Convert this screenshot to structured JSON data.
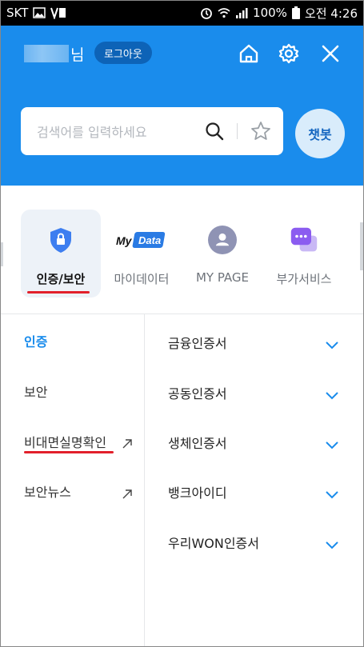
{
  "status_bar": {
    "carrier": "SKT",
    "battery": "100%",
    "time": "오전 4:26"
  },
  "header": {
    "user_suffix": "님",
    "logout_label": "로그아웃",
    "icons": [
      "home-icon",
      "gear-icon",
      "close-icon"
    ]
  },
  "search": {
    "placeholder": "검색어를 입력하세요"
  },
  "chatbot_label": "챗봇",
  "categories": [
    {
      "label": "인증/보안",
      "icon": "shield-lock-icon",
      "active": true
    },
    {
      "label": "마이데이터",
      "icon": "mydata-logo-icon",
      "logo_text": "My Data"
    },
    {
      "label": "MY PAGE",
      "icon": "person-icon"
    },
    {
      "label": "부가서비스",
      "icon": "chat-dots-icon"
    }
  ],
  "left_menu": [
    {
      "label": "인증",
      "active": true
    },
    {
      "label": "보안"
    },
    {
      "label": "비대면실명확인",
      "external": true
    },
    {
      "label": "보안뉴스",
      "external": true
    }
  ],
  "right_menu": [
    {
      "label": "금융인증서"
    },
    {
      "label": "공동인증서"
    },
    {
      "label": "생체인증서"
    },
    {
      "label": "뱅크아이디"
    },
    {
      "label": "우리WON인증서"
    }
  ],
  "colors": {
    "primary_blue": "#1a8cec",
    "highlight_red": "#e2202b",
    "logout_bg": "#0d63b7",
    "chatbot_bg": "#d9ecfb"
  }
}
